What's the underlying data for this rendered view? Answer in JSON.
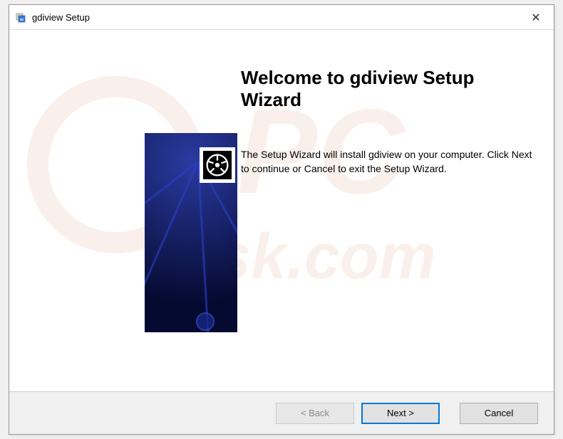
{
  "titlebar": {
    "title": "gdiview Setup",
    "close_symbol": "✕"
  },
  "content": {
    "heading": "Welcome to gdiview Setup Wizard",
    "body": "The Setup Wizard will install gdiview on your computer.  Click Next to continue or Cancel to exit the Setup Wizard."
  },
  "buttons": {
    "back": "< Back",
    "next": "Next >",
    "cancel": "Cancel"
  },
  "watermark": {
    "text1": "PC",
    "text2": "risk.com"
  }
}
